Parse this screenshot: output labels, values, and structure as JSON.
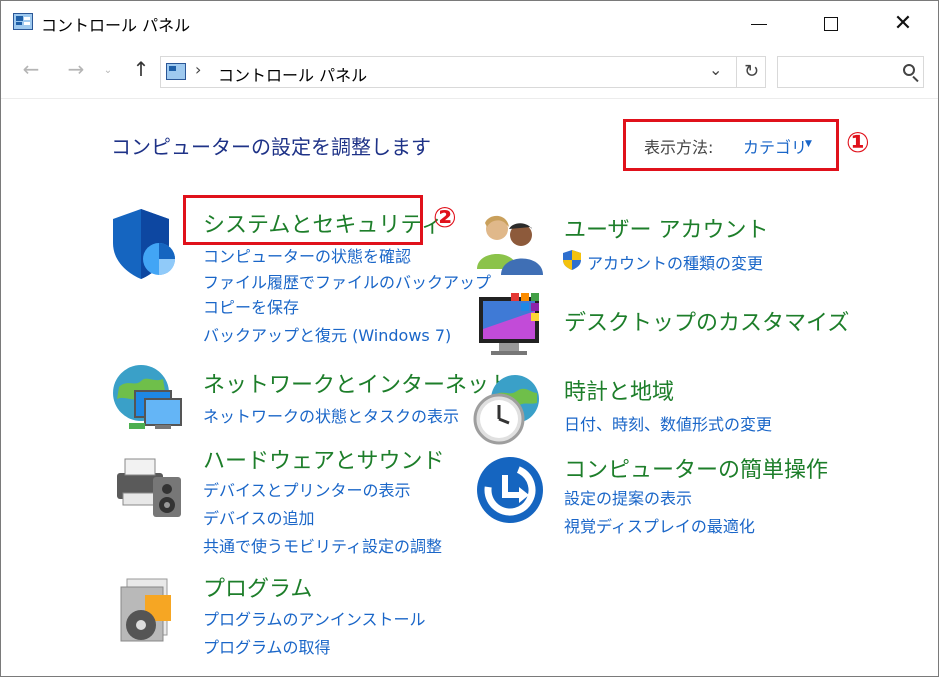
{
  "window": {
    "title": "コントロール パネル",
    "minimize_label": "",
    "maximize_label": "",
    "close_label": "✕"
  },
  "nav": {
    "back_icon": "arrow-left-icon",
    "forward_icon": "arrow-right-icon",
    "up_icon": "arrow-up-icon",
    "address_separator": "›",
    "address_text": "コントロール パネル",
    "search_placeholder": ""
  },
  "content": {
    "heading": "コンピューターの設定を調整します",
    "view_by_label": "表示方法:",
    "view_by_value": "カテゴリ",
    "annotations": [
      "①",
      "②"
    ]
  },
  "categories": {
    "system": {
      "title": "システムとセキュリティ",
      "links": [
        "コンピューターの状態を確認",
        "ファイル履歴でファイルのバックアップ",
        "コピーを保存",
        "バックアップと復元 (Windows 7)"
      ]
    },
    "network": {
      "title": "ネットワークとインターネット",
      "links": [
        "ネットワークの状態とタスクの表示"
      ]
    },
    "hardware": {
      "title": "ハードウェアとサウンド",
      "links": [
        "デバイスとプリンターの表示",
        "デバイスの追加",
        "共通で使うモビリティ設定の調整"
      ]
    },
    "programs": {
      "title": "プログラム",
      "links": [
        "プログラムのアンインストール",
        "プログラムの取得"
      ]
    },
    "users": {
      "title": "ユーザー アカウント",
      "links": [
        "アカウントの種類の変更"
      ]
    },
    "appearance": {
      "title": "デスクトップのカスタマイズ",
      "links": []
    },
    "clock": {
      "title": "時計と地域",
      "links": [
        "日付、時刻、数値形式の変更"
      ]
    },
    "ease": {
      "title": "コンピューターの簡単操作",
      "links": [
        "設定の提案の表示",
        "視覚ディスプレイの最適化"
      ]
    }
  },
  "colors": {
    "category_title": "#1d7e2a",
    "link": "#1a66c8",
    "heading": "#1e3287",
    "annotation_red": "#e0111b"
  }
}
